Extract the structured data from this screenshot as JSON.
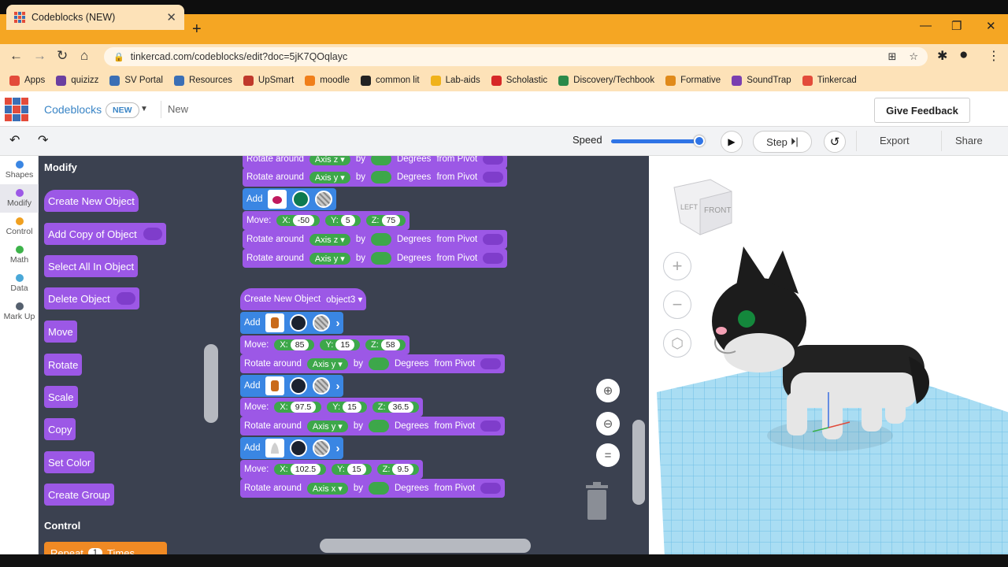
{
  "browser": {
    "tab_title": "Codeblocks (NEW)",
    "url": "tinkercad.com/codeblocks/edit?doc=5jK7QOqlayc",
    "bookmarks": [
      {
        "label": "Apps",
        "color": "#e34b3a"
      },
      {
        "label": "quizizz",
        "color": "#6b3fa0"
      },
      {
        "label": "SV Portal",
        "color": "#3b6fb5"
      },
      {
        "label": "Resources",
        "color": "#3b6fb5"
      },
      {
        "label": "UpSmart",
        "color": "#c0392b"
      },
      {
        "label": "moodle",
        "color": "#f07f1a"
      },
      {
        "label": "common lit",
        "color": "#222222"
      },
      {
        "label": "Lab-aids",
        "color": "#f0b21a"
      },
      {
        "label": "Scholastic",
        "color": "#d62828"
      },
      {
        "label": "Discovery/Techbook",
        "color": "#2a8a4a"
      },
      {
        "label": "Formative",
        "color": "#e08a1a"
      },
      {
        "label": "SoundTrap",
        "color": "#7a3fb0"
      },
      {
        "label": "Tinkercad",
        "color": "#e34b3a"
      }
    ]
  },
  "header": {
    "app_name": "Codeblocks",
    "badge": "NEW",
    "doc_name": "New",
    "feedback_label": "Give Feedback"
  },
  "toolbar": {
    "speed_label": "Speed",
    "speed_value": 0.92,
    "step_label": "Step",
    "export_label": "Export",
    "share_label": "Share"
  },
  "categories": [
    {
      "label": "Shapes",
      "color": "#3a86e3"
    },
    {
      "label": "Modify",
      "color": "#9c58e6"
    },
    {
      "label": "Control",
      "color": "#f0a020"
    },
    {
      "label": "Math",
      "color": "#3db34a"
    },
    {
      "label": "Data",
      "color": "#4aa8d8"
    },
    {
      "label": "Mark Up",
      "color": "#55606e"
    }
  ],
  "flyout": {
    "heading": "Modify",
    "blocks": [
      "Create New Object",
      "Add Copy of Object",
      "Select All In Object",
      "Delete Object",
      "Move",
      "Rotate",
      "Scale",
      "Copy",
      "Set Color",
      "Create Group"
    ],
    "control_heading": "Control",
    "repeat_label": "Repeat",
    "repeat_count": "1",
    "repeat_suffix": "Times"
  },
  "workspace": {
    "rotate_label": "Rotate around",
    "by_label": "by",
    "degrees_label": "Degrees",
    "pivot_label": "from Pivot",
    "add_label": "Add",
    "move_label": "Move:",
    "create_label": "Create New Object",
    "axis_z": "Axis z",
    "axis_y": "Axis y",
    "axis_x": "Axis x",
    "object3": "object3",
    "x_label": "X:",
    "y_label": "Y:",
    "z_label": "Z:",
    "move1": {
      "x": "-50",
      "y": "5",
      "z": "75"
    },
    "move2": {
      "x": "85",
      "y": "15",
      "z": "58"
    },
    "move3": {
      "x": "97.5",
      "y": "15",
      "z": "36.5"
    },
    "move4": {
      "x": "102.5",
      "y": "15",
      "z": "9.5"
    }
  },
  "viewcube": {
    "left": "LEFT",
    "front": "FRONT"
  },
  "colors": {
    "modify_block": "#9c58e6",
    "shape_block": "#3a86e3",
    "workspace_bg": "#3b4150",
    "accent_orange": "#f5a623"
  }
}
